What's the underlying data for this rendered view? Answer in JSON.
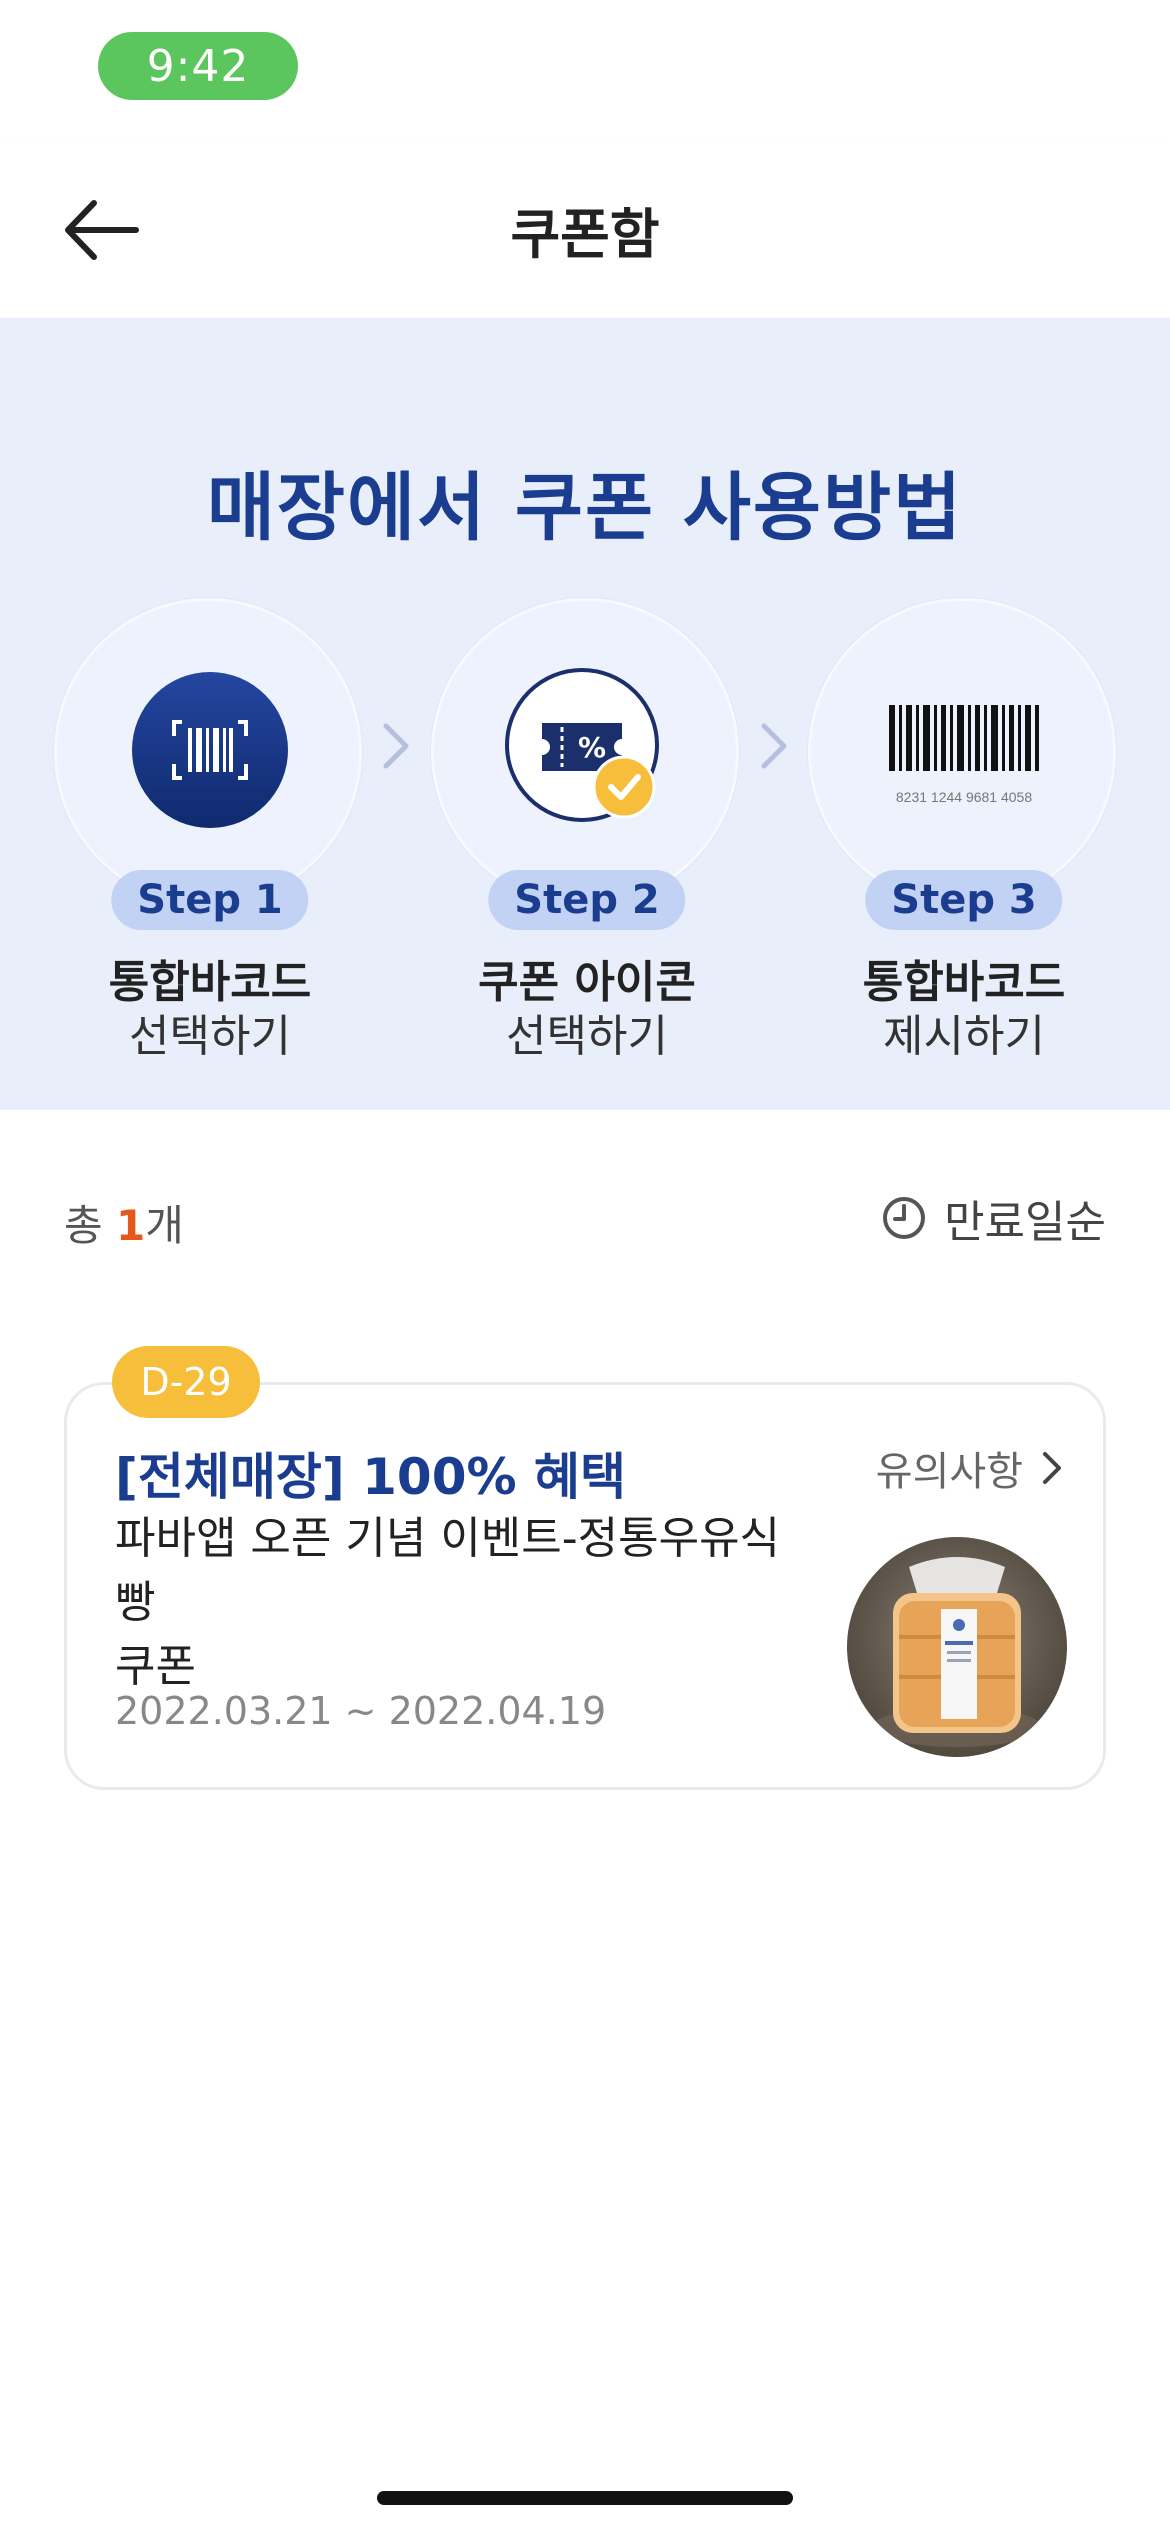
{
  "status_bar": {
    "time": "9:42"
  },
  "header": {
    "title": "쿠폰함"
  },
  "guide": {
    "title": "매장에서 쿠폰 사용방법",
    "steps": [
      {
        "badge": "Step 1",
        "line1": "통합바코드",
        "line2": "선택하기",
        "icon": "barcode-scan-icon"
      },
      {
        "badge": "Step 2",
        "line1": "쿠폰 아이콘",
        "line2": "선택하기",
        "icon": "coupon-ticket-check-icon"
      },
      {
        "badge": "Step 3",
        "line1": "통합바코드",
        "line2": "제시하기",
        "icon": "barcode-icon",
        "barcode_number": "8231 1244 9681 4058"
      }
    ]
  },
  "list": {
    "count_prefix": "총 ",
    "count": "1",
    "count_suffix": "개",
    "sort_label": "만료일순"
  },
  "coupon": {
    "dday": "D-29",
    "title": "[전체매장] 100% 혜택",
    "notice_label": "유의사항",
    "desc_line1": "파바앱 오픈 기념 이벤트-정통우유식빵",
    "desc_line2": "쿠폰",
    "period": "2022.03.21 ~ 2022.04.19",
    "product_label": "정통우유식빵"
  },
  "colors": {
    "accent_blue": "#1a3d8f",
    "guide_bg": "#e9eefb",
    "badge_bg": "#c2d2f4",
    "dday_yellow": "#f7be3b",
    "count_orange": "#e55a1c",
    "status_green": "#5cc65e"
  }
}
